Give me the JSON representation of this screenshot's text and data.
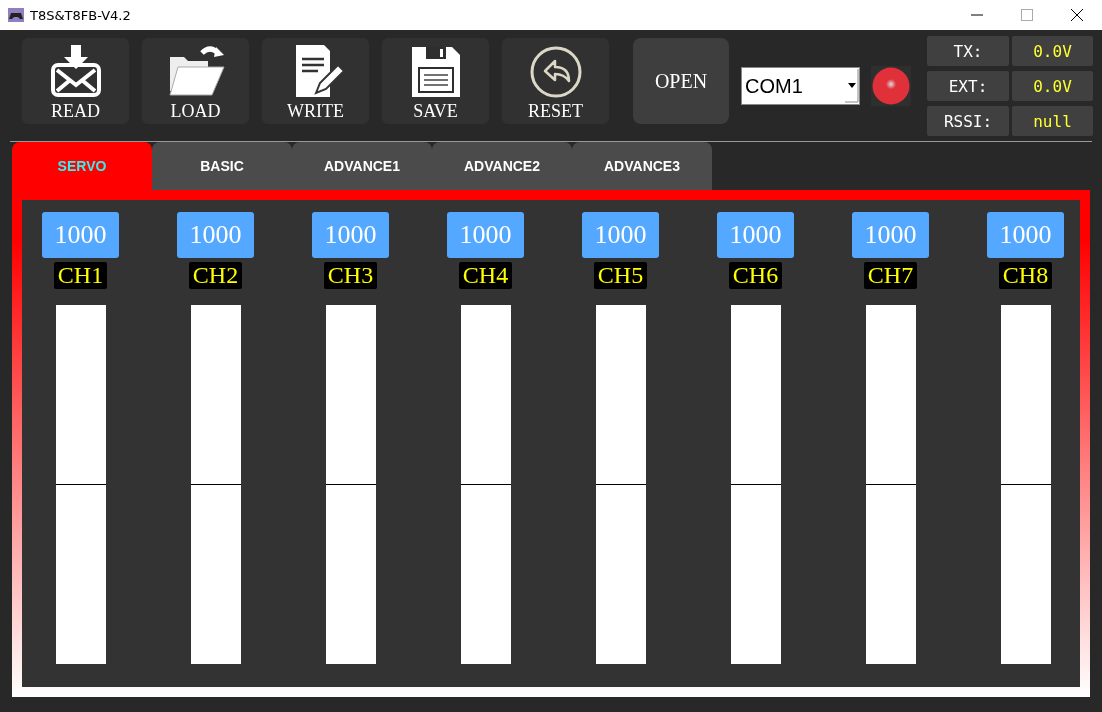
{
  "window": {
    "title": "T8S&T8FB-V4.2"
  },
  "toolbar": [
    {
      "kind": "read",
      "label": "READ"
    },
    {
      "kind": "load",
      "label": "LOAD"
    },
    {
      "kind": "write",
      "label": "WRITE"
    },
    {
      "kind": "save",
      "label": "SAVE"
    },
    {
      "kind": "reset",
      "label": "RESET"
    }
  ],
  "open_button": "OPEN",
  "port": {
    "value": "COM1"
  },
  "connection": {
    "color": "#e0303a"
  },
  "status": [
    {
      "label": "TX:",
      "value": "0.0V"
    },
    {
      "label": "EXT:",
      "value": "0.0V"
    },
    {
      "label": "RSSI:",
      "value": "null"
    }
  ],
  "tabs": [
    {
      "label": "SERVO",
      "selected": true
    },
    {
      "label": "BASIC",
      "selected": false
    },
    {
      "label": "ADVANCE1",
      "selected": false
    },
    {
      "label": "ADVANCE2",
      "selected": false
    },
    {
      "label": "ADVANCE3",
      "selected": false
    }
  ],
  "channels": [
    {
      "value": "1000",
      "name": "CH1"
    },
    {
      "value": "1000",
      "name": "CH2"
    },
    {
      "value": "1000",
      "name": "CH3"
    },
    {
      "value": "1000",
      "name": "CH4"
    },
    {
      "value": "1000",
      "name": "CH5"
    },
    {
      "value": "1000",
      "name": "CH6"
    },
    {
      "value": "1000",
      "name": "CH7"
    },
    {
      "value": "1000",
      "name": "CH8"
    }
  ]
}
